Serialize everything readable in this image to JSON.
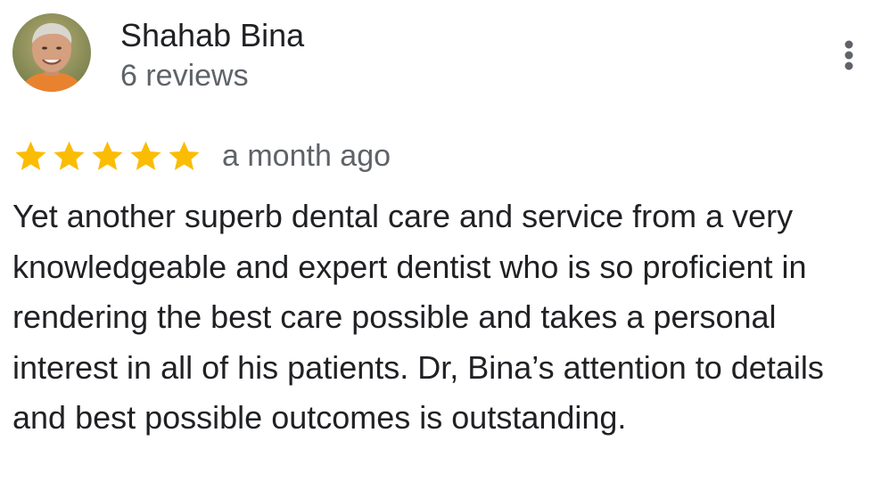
{
  "review": {
    "author_name": "Shahab Bina",
    "review_count": "6 reviews",
    "avatar_icon": "profile-photo",
    "menu_icon": "more-vert-icon",
    "rating": 5,
    "rating_max": 5,
    "date": "a month ago",
    "text": "Yet another superb dental care and service from a very knowledgeable and expert dentist who is so proficient in rendering the best care possible and takes a personal interest in all of his patients. Dr, Bina’s attention to details and best possible outcomes is outstanding."
  },
  "colors": {
    "star": "#fbbc04",
    "star_empty": "#dadce0",
    "primary_text": "#202124",
    "secondary_text": "#5f6368",
    "menu_icon": "#5f6368"
  }
}
